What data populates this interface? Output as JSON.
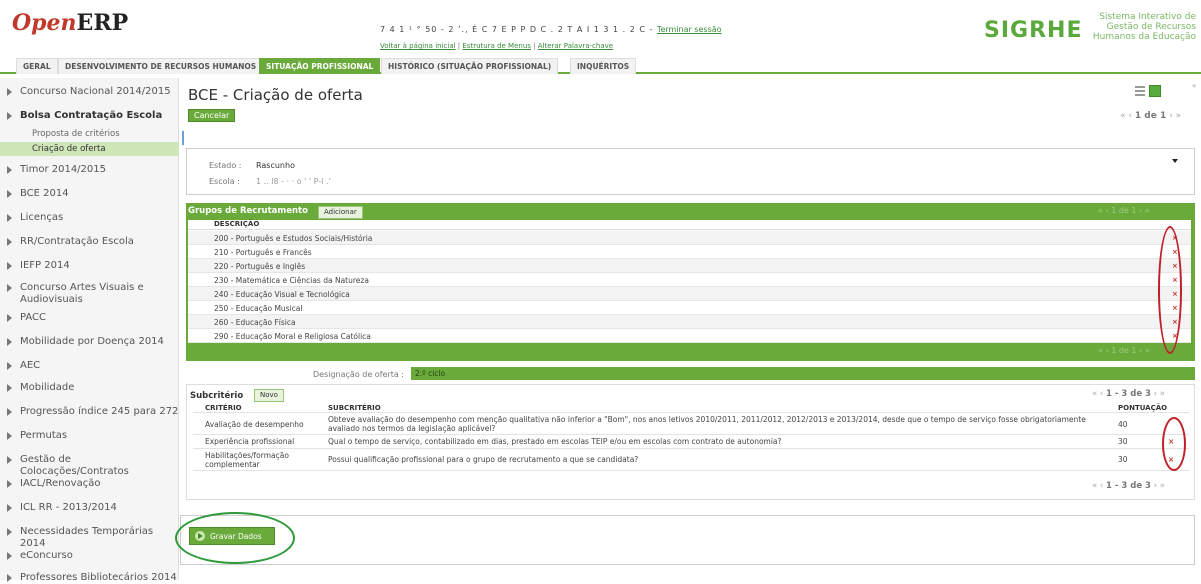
{
  "header": {
    "logo_open": "Open",
    "logo_erp": "ERP",
    "user_line": "7 4 1 ¹ ° 50 - 2 ’., É C 7 E P P D C . 2 T A I 1 3 1 . 2 C -",
    "logout_label": "Terminar sessão",
    "links": [
      "Voltar à página inicial",
      "Estrutura de Menus",
      "Alterar Palavra-chave"
    ],
    "sigrhe": "SIGRHE",
    "sigrhe_sub": [
      "Sistema Interativo de",
      "Gestão de Recursos",
      "Humanos da Educação"
    ]
  },
  "tabs": [
    "GERAL",
    "DESENVOLVIMENTO DE RECURSOS HUMANOS",
    "SITUAÇÃO PROFISSIONAL",
    "HISTÓRICO (SITUAÇÃO PROFISSIONAL)",
    "INQUÉRITOS"
  ],
  "active_tab": "SITUAÇÃO PROFISSIONAL",
  "sidebar": {
    "items": [
      "Concurso Nacional 2014/2015",
      "Bolsa Contratação Escola",
      "Timor 2014/2015",
      "BCE 2014",
      "Licenças",
      "RR/Contratação Escola",
      "IEFP 2014",
      "Concurso Artes Visuais e Audiovisuais",
      "PACC",
      "Mobilidade por Doença 2014",
      "AEC",
      "Mobilidade",
      "Progressão índice 245 para 272",
      "Permutas",
      "Gestão de Colocações/Contratos",
      "IACL/Renovação",
      "ICL RR - 2013/2014",
      "Necessidades Temporárias 2014",
      "eConcurso",
      "Professores Bibliotecários 2014"
    ],
    "subitems": [
      "Proposta de critérios",
      "Criação de oferta"
    ],
    "active_subitem": "Criação de oferta"
  },
  "main": {
    "title": "BCE - Criação de oferta",
    "cancel_label": "Cancelar",
    "pager_top": "1 de 1",
    "estado_label": "Estado :",
    "estado_value": "Rascunho",
    "escola_label": "Escola :",
    "escola_value": "1 .. l8 - · · o  ' '  P-l  .’"
  },
  "grupos": {
    "title": "Grupos de Recrutamento",
    "add_label": "Adicionar",
    "col_header": "DESCRIÇÃO",
    "rows": [
      "200 - Português e Estudos Sociais/História",
      "210 - Português e Francês",
      "220 - Português e Inglês",
      "230 - Matemática e Ciências da Natureza",
      "240 - Educação Visual e Tecnológica",
      "250 - Educação Musical",
      "260 - Educação Física",
      "290 - Educação Moral e Religiosa Católica"
    ],
    "delete_glyph": "×",
    "pager": "1 de 1"
  },
  "designacao": {
    "label": "Designação de oferta :",
    "value": "2.º ciclo"
  },
  "subcriterio": {
    "title": "Subcritério",
    "new_label": "Novo",
    "pager": "1 - 3 de 3",
    "headers": [
      "CRITÉRIO",
      "SUBCRITÉRIO",
      "PONTUAÇÃO"
    ],
    "rows": [
      {
        "criterio": "Avaliação de desempenho",
        "subcriterio": "Obteve avaliação do desempenho com menção qualitativa não inferior a \"Bom\", nos anos letivos 2010/2011, 2011/2012, 2012/2013 e 2013/2014, desde que o tempo de serviço fosse obrigatoriamente avaliado nos termos da legislação aplicável?",
        "pontuacao": "40"
      },
      {
        "criterio": "Experiência profissional",
        "subcriterio": "Qual o tempo de serviço, contabilizado em dias, prestado em escolas TEIP e/ou em escolas com contrato de autonomia?",
        "pontuacao": "30"
      },
      {
        "criterio": "Habilitações/formação complementar",
        "subcriterio": "Possui qualificação profissional para o grupo de recrutamento a que se candidata?",
        "pontuacao": "30"
      }
    ],
    "delete_glyph": "×",
    "pager_bottom": "1 - 3 de 3"
  },
  "save_label": "Gravar Dados",
  "colors": {
    "accent_green": "#6aaa3a",
    "logo_red": "#c0392b",
    "annotation_red": "#c0202a",
    "annotation_green": "#2e9a3a"
  }
}
